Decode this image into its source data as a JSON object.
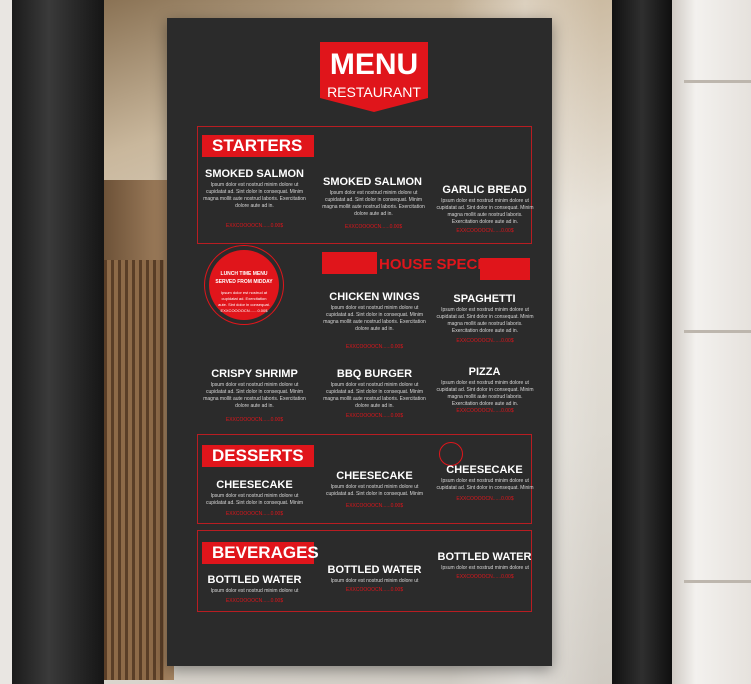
{
  "menu": {
    "title": "MENU",
    "subtitle": "RESTAURANT",
    "starters": {
      "label": "STARTERS",
      "items": [
        "SMOKED SALMON",
        "SMOKED SALMON",
        "GARLIC BREAD"
      ]
    },
    "house_special": {
      "label": "HOUSE SPECIAL",
      "items": [
        "CHICKEN WINGS",
        "SPAGHETTI",
        "CRISPY SHRIMP",
        "BBQ  BURGER",
        "PIZZA"
      ]
    },
    "badge": {
      "line1": "LUNCH TIME MENU",
      "line2": "SERVED FROM MIDDAY",
      "body": "Ipsum dolor est nostrud at cupidatat ad. Exercitation aute. Sint dolor in consequat. EXXCOOOOCN.......0.00$"
    },
    "desserts": {
      "label": "DESSERTS",
      "items": [
        "CHEESECAKE",
        "CHEESECAKE",
        "CHEESECAKE"
      ]
    },
    "beverages": {
      "label": "BEVERAGES",
      "items": [
        "BOTTLED WATER",
        "BOTTLED WATER",
        "BOTTLED WATER"
      ]
    },
    "filler_text": "Ipsum dolor est nostrud minim dolore ut cupidatat ad. Sint dolor in consequat. Minim magna mollit aute nostrud laboris. Exercitation dolore aute ad in.",
    "price_text": "EXXCOOOOCN......0.00$"
  },
  "colors": {
    "accent": "#e0151b",
    "board": "#2b2b2b"
  }
}
